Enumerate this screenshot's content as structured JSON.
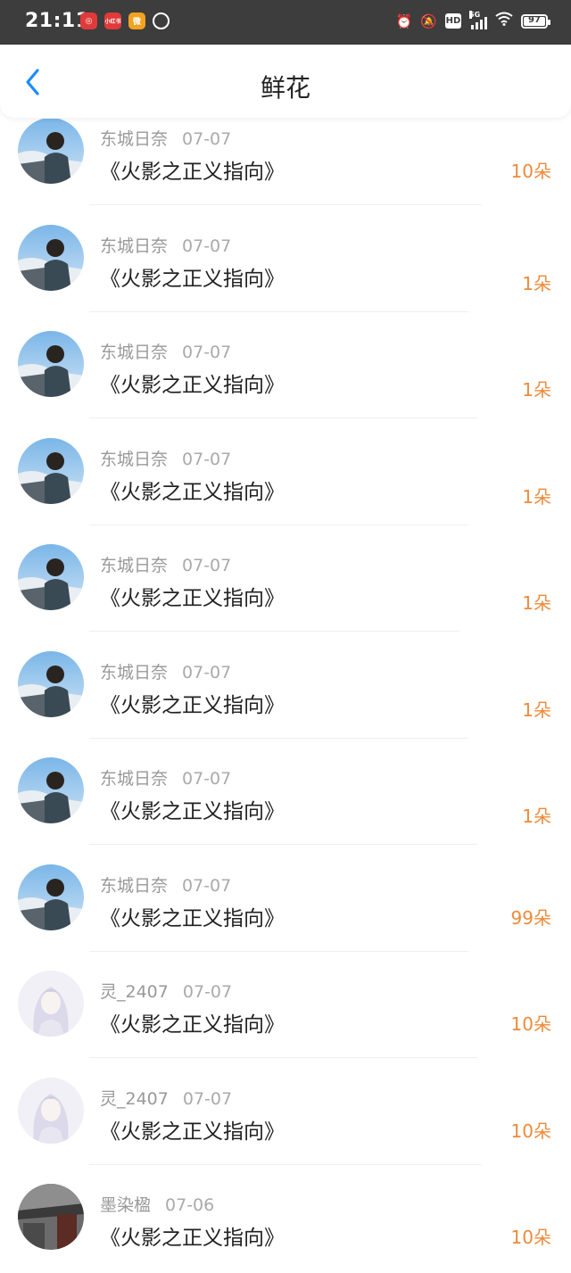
{
  "status_bar": {
    "time": "21:11",
    "battery": "97",
    "network": "5G",
    "hd": "HD",
    "apps": [
      {
        "icon": "netease-music-icon",
        "color": "#e03a3a",
        "label": "◎"
      },
      {
        "icon": "xiaohongshu-icon",
        "color": "#e03a3a",
        "label": "小红书"
      },
      {
        "icon": "weibo-icon",
        "color": "#f2a21e",
        "label": "微"
      },
      {
        "icon": "circle-app-icon",
        "color": "#3d3d3d",
        "label": "Ⓛ"
      }
    ]
  },
  "header": {
    "title": "鲜花",
    "back_icon": "chevron-left-icon",
    "accent": "#1a8cff"
  },
  "colors": {
    "amount": "#ee8a3a"
  },
  "list": [
    {
      "user": "东城日奈",
      "date": "07-07",
      "book": "《火影之正义指向》",
      "amount": "10朵",
      "avatar": "sky-boy"
    },
    {
      "user": "东城日奈",
      "date": "07-07",
      "book": "《火影之正义指向》",
      "amount": "1朵",
      "avatar": "sky-boy"
    },
    {
      "user": "东城日奈",
      "date": "07-07",
      "book": "《火影之正义指向》",
      "amount": "1朵",
      "avatar": "sky-boy"
    },
    {
      "user": "东城日奈",
      "date": "07-07",
      "book": "《火影之正义指向》",
      "amount": "1朵",
      "avatar": "sky-boy"
    },
    {
      "user": "东城日奈",
      "date": "07-07",
      "book": "《火影之正义指向》",
      "amount": "1朵",
      "avatar": "sky-boy"
    },
    {
      "user": "东城日奈",
      "date": "07-07",
      "book": "《火影之正义指向》",
      "amount": "1朵",
      "avatar": "sky-boy"
    },
    {
      "user": "东城日奈",
      "date": "07-07",
      "book": "《火影之正义指向》",
      "amount": "1朵",
      "avatar": "sky-boy"
    },
    {
      "user": "东城日奈",
      "date": "07-07",
      "book": "《火影之正义指向》",
      "amount": "99朵",
      "avatar": "sky-boy"
    },
    {
      "user": "灵_2407",
      "date": "07-07",
      "book": "《火影之正义指向》",
      "amount": "10朵",
      "avatar": "anime-girl"
    },
    {
      "user": "灵_2407",
      "date": "07-07",
      "book": "《火影之正义指向》",
      "amount": "10朵",
      "avatar": "anime-girl"
    },
    {
      "user": "墨染楹",
      "date": "07-06",
      "book": "《火影之正义指向》",
      "amount": "10朵",
      "avatar": "dark-architecture"
    }
  ]
}
